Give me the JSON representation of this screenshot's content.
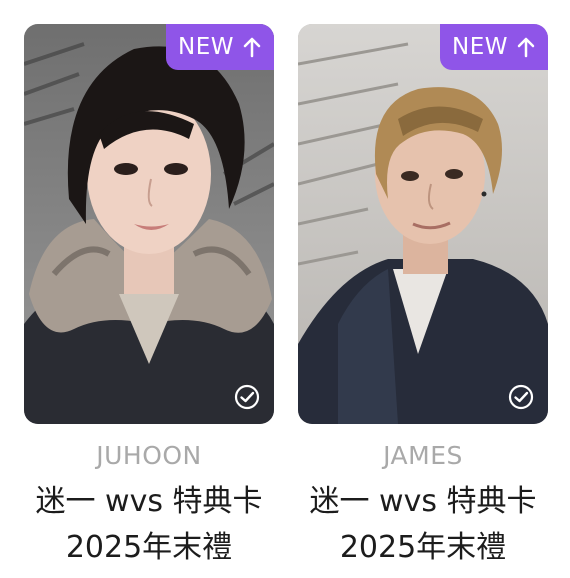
{
  "badge_label": "NEW",
  "colors": {
    "badge": "#8f55e8",
    "name_text": "#a9a9a9",
    "title_text": "#1c1c1c"
  },
  "cards": [
    {
      "name": "JUHOON",
      "title": "迷一 wvs 特典卡 2025年末禮"
    },
    {
      "name": "JAMES",
      "title": "迷一 wvs 特典卡 2025年末禮"
    }
  ]
}
